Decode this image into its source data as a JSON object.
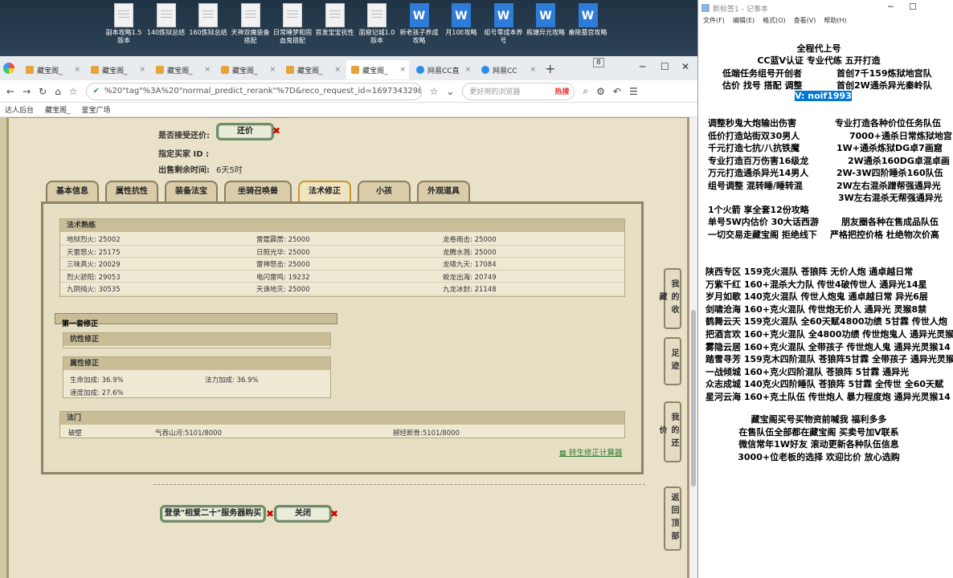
{
  "desktop": {
    "icons": [
      {
        "label": "副本攻略1.5版本",
        "type": "doc"
      },
      {
        "label": "140炼狱总结",
        "type": "doc"
      },
      {
        "label": "160炼狱总结",
        "type": "doc"
      },
      {
        "label": "天神双魔装备搭配",
        "type": "doc"
      },
      {
        "label": "日常睡梦和固血鬼搭配",
        "type": "doc"
      },
      {
        "label": "首发宝宝抗性",
        "type": "doc"
      },
      {
        "label": "面窟记城1.0版本",
        "type": "doc"
      },
      {
        "label": "新老孩子养成攻略",
        "type": "wps"
      },
      {
        "label": "月10E攻略",
        "type": "wps"
      },
      {
        "label": "组号零成本养号",
        "type": "wps"
      },
      {
        "label": "瓶塘异光攻略",
        "type": "wps"
      },
      {
        "label": "秦陵墓宫攻略",
        "type": "wps"
      }
    ]
  },
  "browser": {
    "tabs": [
      {
        "label": "藏宝阁_",
        "active": false
      },
      {
        "label": "藏宝阁_",
        "active": false
      },
      {
        "label": "藏宝阁_",
        "active": false
      },
      {
        "label": "藏宝阁_",
        "active": false
      },
      {
        "label": "藏宝阁_",
        "active": false
      },
      {
        "label": "藏宝阁_",
        "active": true
      },
      {
        "label": "网易CC直",
        "active": false
      },
      {
        "label": "网易CC",
        "active": false
      }
    ],
    "tab_count": "8",
    "url": "%20\"tag\"%3A%20\"normal_predict_rerank\"%7D&reco_request_id=1697343298134TyrE1",
    "search_placeholder": "更好用的浏览器",
    "hot_label": "热搜",
    "bookmarks": [
      "达人后台",
      "藏宝阁_",
      "鉴宝广场"
    ]
  },
  "game": {
    "accept_bargain_label": "是否接受还价:",
    "bargain_button": "还价",
    "buyer_id_label": "指定买家 ID :",
    "time_left_label": "出售剩余时间:",
    "time_left_value": "6天5时",
    "tabs": [
      "基本信息",
      "属性抗性",
      "装备法宝",
      "坐骑召唤兽",
      "法术修正",
      "小孩",
      "外观道具"
    ],
    "active_tab": "法术修正",
    "spell_mastery": {
      "title": "法术熟练",
      "rows": [
        [
          "地狱烈火: 25002",
          "雷霆霹雳: 25000",
          "龙卷雨击: 25000"
        ],
        [
          "天雷怒火: 25175",
          "日照光华: 25000",
          "龙腾水溅: 25000"
        ],
        [
          "三味真火: 20029",
          "雷神怒击: 25000",
          "龙啸九天: 17084"
        ],
        [
          "烈火骄阳: 29053",
          "电闪雷鸣: 19232",
          "蛟龙出海: 20749"
        ],
        [
          "九阴纯火: 30535",
          "天诛地灭: 25000",
          "九龙冰封: 21148"
        ]
      ]
    },
    "first_set": {
      "title": "第一套修正",
      "resist_title": "抗性修正",
      "attr_title": "属性修正",
      "attrs": [
        {
          "label": "生命加成:",
          "value": "36.9%"
        },
        {
          "label": "法力加成:",
          "value": "36.9%"
        },
        {
          "label": "速度加成:",
          "value": "27.6%"
        }
      ]
    },
    "fabao": {
      "title": "法门",
      "items": [
        "破壁",
        "气吞山河:5101/8000",
        "撼经断骨:5101/8000"
      ]
    },
    "calc_link": "转生修正计算器",
    "buy_button": "登录\"相爱二十\"服务器购买",
    "close_button": "关闭",
    "side_buttons": [
      "我的收藏",
      "足迹",
      "我的还价",
      "返回顶部"
    ]
  },
  "notepad": {
    "title": "新标签1 - 记事本",
    "menu": [
      "文件(F)",
      "编辑(E)",
      "格式(O)",
      "查看(V)",
      "帮助(H)"
    ],
    "header_lines": [
      "全程代上号",
      "CC蓝V认证  专业代练  五开打造",
      "低端任务组号开创者",
      "首创7千159炼狱地宫队",
      "估价 找号 搭配 调整",
      "首创2W通杀异光秦岭队"
    ],
    "contact": "V: noif1993",
    "services_left": [
      "调整秒鬼大炮输出伤害",
      "低价打造站街双30男人",
      "千元打造七抗/八抗铁魔",
      "专业打造百万伤害16级龙",
      "万元打造通杀异光14男人",
      "组号调整 混转睡/睡转混"
    ],
    "services_right": [
      "专业打造各种价位任务队伍",
      "7000+通杀日常炼狱地宫",
      "1W+通杀炼狱DG卓7画窟",
      "2W通杀160DG卓混卓画",
      "2W-3W四阶睡杀160队伍",
      "2W左右混杀蹭帮强通异光",
      "3W左右混杀无帮强通异光"
    ],
    "extra_lines": [
      "1个火箭 享全套12份攻略",
      "单号5W内估价 30大话西游",
      "朋友圈各种在售成品队伍",
      "一切交易走藏宝阁 拒绝线下",
      "严格把控价格 杜绝物次价高"
    ],
    "teams": [
      "陕西专区 159克火混队 苍狼阵 无价人炮 通卓越日常",
      "万紫千红 160+混杀大力队 传世4破传世人 通异光14星",
      "岁月如歌 140克火混队 传世人炮鬼 通卓越日常 异光6层",
      "剑啸沧海 160+克火混队 传世炮无价人 通异光 灵猴8禁",
      "鹤舞云天 159克火混队 全60天赋4800功绩 5甘霖 传世人炮",
      "把酒言欢 160+克火混队 全4800功绩 传世炮鬼人 通异光灵猴",
      "雾隐云居 160+克火混队 全带孩子 传世炮人鬼 通异光灵猴14",
      "踏雪寻芳 159克木四阶混队 苍狼阵5甘霖 全带孩子 通异光灵猴",
      "一战倾城 160+克火四阶混队 苍狼阵 5甘霖 通异光",
      "众志成城 140克火四阶睡队 苍狼阵 5甘霖 全传世 全60天赋",
      "星河云海 160+克土队伍 传世炮人 暴力程度炮 通异光灵猴14"
    ],
    "footer_lines": [
      "藏宝阁买号买物资前喊我 福利多多",
      "在售队伍全部都在藏宝阁 买卖号加V联系",
      "微信常年1W好友 滚动更新各种队伍信息",
      "3000+位老板的选择 欢迎比价 放心选购"
    ]
  }
}
